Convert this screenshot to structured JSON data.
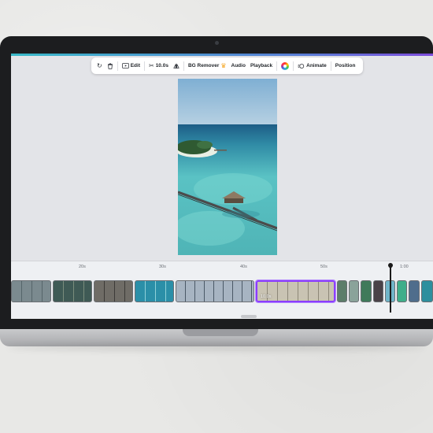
{
  "toolbar": {
    "edit_label": "Edit",
    "duration_label": "10.0s",
    "bg_remover_label": "BG Remover",
    "audio_label": "Audio",
    "playback_label": "Playback",
    "animate_label": "Animate",
    "position_label": "Position"
  },
  "timeline": {
    "ruler_labels": [
      "20s",
      "30s",
      "40s",
      "50s",
      "1:00"
    ],
    "selected_clip_duration": "10.0s"
  },
  "colors": {
    "accent_selection": "#8b3dff",
    "screen_background": "#e3e4e8",
    "laptop_frame": "#1c1d1f"
  }
}
